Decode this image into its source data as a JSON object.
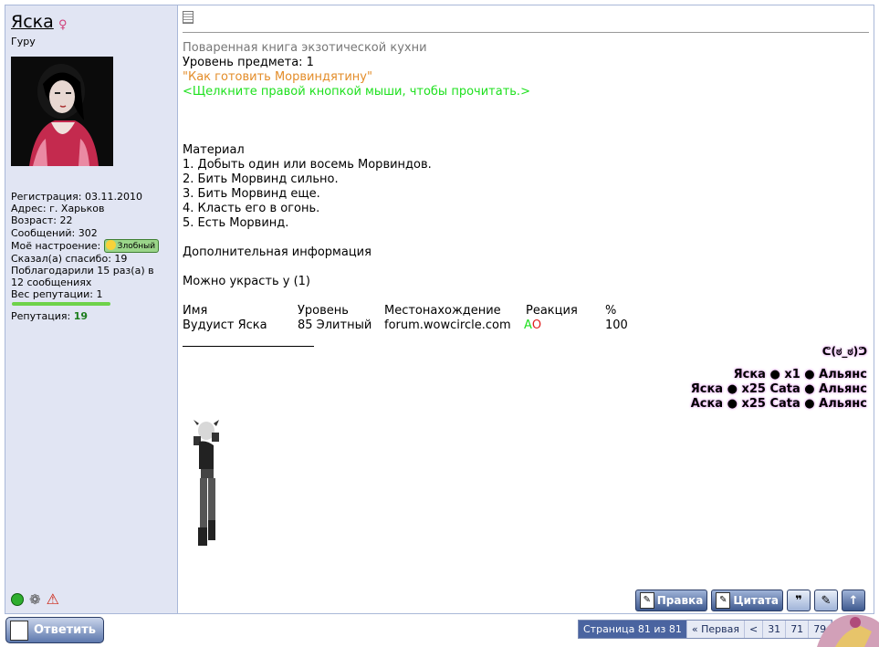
{
  "sidebar": {
    "username": "Яска",
    "rank": "Гуру",
    "registration": "Регистрация: 03.11.2010",
    "address": "Адрес: г. Харьков",
    "age": "Возраст: 22",
    "messages": "Сообщений: 302",
    "mood_label": "Моё настроение:",
    "mood_value": "Злобный",
    "thanked": "Сказал(а) спасибо: 19",
    "thanks_received_1": "Поблагодарили 15 раз(а) в",
    "thanks_received_2": "12 сообщениях",
    "rep_weight": "Вес репутации: 1",
    "reputation_label": "Репутация:",
    "reputation_value": "19"
  },
  "post": {
    "item_name": "Поваренная книга экзотической кухни",
    "item_level": "Уровень предмета: 1",
    "item_quote": "\"Как готовить Морвиндятину\"",
    "item_hint": "<Щелкните правой кнопкой мыши, чтобы прочитать.>",
    "material_title": "Материал",
    "steps": [
      "1. Добыть один или восемь Морвиндов.",
      "2. Бить Морвинд сильно.",
      "3. Бить Морвинд еще.",
      "4. Класть его в огонь.",
      "5. Есть Морвинд."
    ],
    "extra_info": "Дополнительная информация",
    "steal_from": "Можно украсть у (1)",
    "table": {
      "headers": [
        "Имя",
        "Уровень",
        "Местонахождение",
        "Реакция",
        "%"
      ],
      "row": {
        "name": "Вудуист Яска",
        "level": "85 Элитный",
        "location": "forum.wowcircle.com",
        "reaction_a": "А",
        "reaction_o": "О",
        "percent": "100"
      }
    }
  },
  "signature": {
    "face": "ᕦ(ಠ_ಠ)ᕤ",
    "lines": [
      "Яска ● x1          ● Альянс",
      "Яска ● x25 Cata ● Альянс",
      "Аска ● x25 Cata ● Альянс"
    ]
  },
  "buttons": {
    "edit": "Правка",
    "quote": "Цитата",
    "reply": "Ответить"
  },
  "pagination": {
    "current": "Страница 81 из 81",
    "first": "« Первая",
    "prev": "<",
    "pages": [
      "31",
      "71",
      "79"
    ]
  },
  "colors": {
    "sidebar_bg": "#e1e5f3",
    "item_quote": "#e38d2a",
    "item_hint": "#1ee01e",
    "reputation": "#1c7d1c",
    "reaction_a": "#1ee01e",
    "reaction_o": "#e01e1e"
  },
  "icons": [
    "gender-female-icon",
    "online-status-icon",
    "reputation-icon",
    "report-warning-icon",
    "post-document-icon",
    "multiquote-icon",
    "quick-reply-icon",
    "scroll-top-icon"
  ]
}
